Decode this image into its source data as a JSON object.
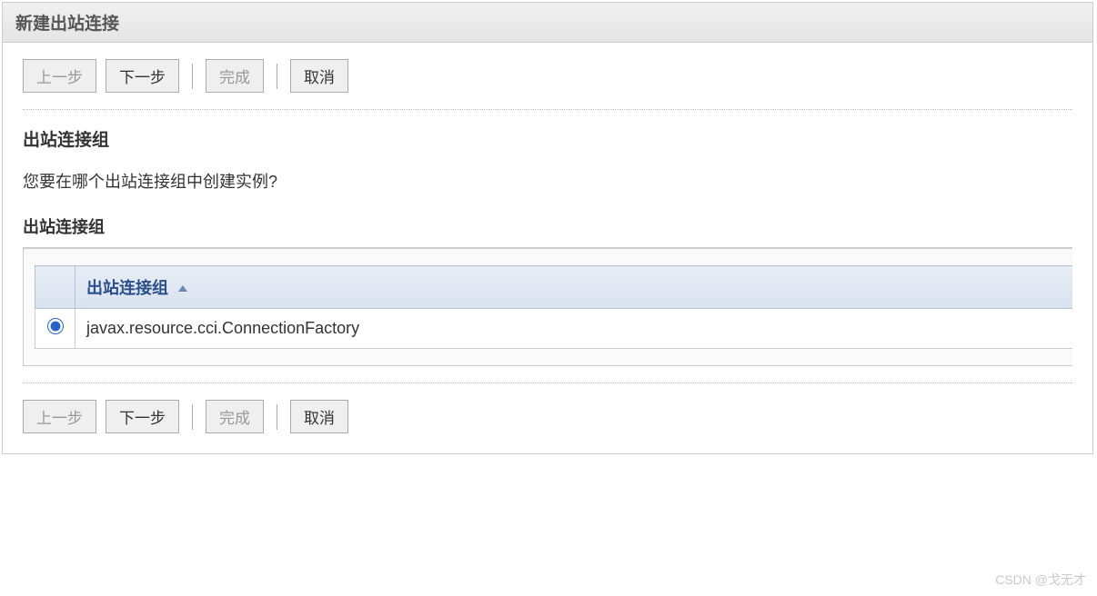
{
  "header": {
    "title": "新建出站连接"
  },
  "buttons": {
    "back": "上一步",
    "next": "下一步",
    "finish": "完成",
    "cancel": "取消"
  },
  "content": {
    "section_title": "出站连接组",
    "description": "您要在哪个出站连接组中创建实例?",
    "table_label": "出站连接组",
    "column_header": "出站连接组",
    "rows": [
      {
        "value": "javax.resource.cci.ConnectionFactory",
        "selected": true
      }
    ]
  },
  "watermark": "CSDN @戈无才"
}
